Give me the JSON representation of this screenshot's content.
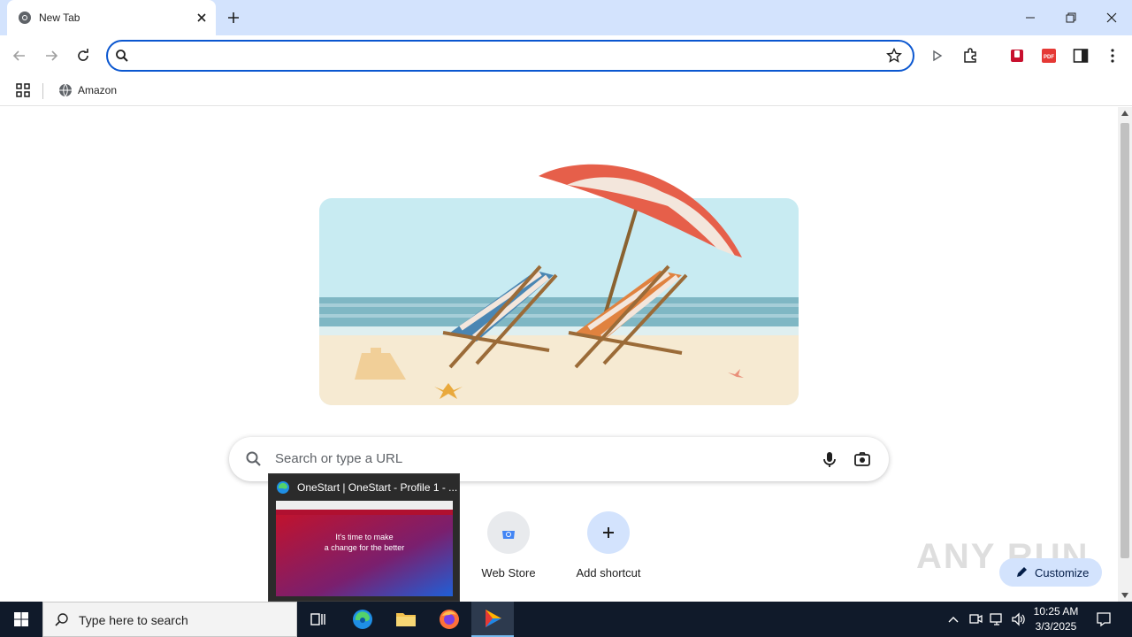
{
  "tab": {
    "title": "New Tab"
  },
  "omnibox": {
    "value": ""
  },
  "bookmarks": [
    {
      "label": "Amazon"
    }
  ],
  "ntp": {
    "search_placeholder": "Search or type a URL",
    "shortcuts": [
      {
        "label": "Web Store"
      },
      {
        "label": "Add shortcut"
      }
    ],
    "customize_label": "Customize",
    "watermark": "ANY RUN"
  },
  "preview": {
    "title": "OneStart | OneStart - Profile 1 - ...",
    "headline_1": "It's time to make",
    "headline_2": "a change for the better"
  },
  "taskbar": {
    "search_placeholder": "Type here to search",
    "time": "10:25 AM",
    "date": "3/3/2025"
  },
  "colors": {
    "tab_strip": "#d3e3fd",
    "omnibox_border": "#0b57d0",
    "taskbar": "#101a2a"
  }
}
